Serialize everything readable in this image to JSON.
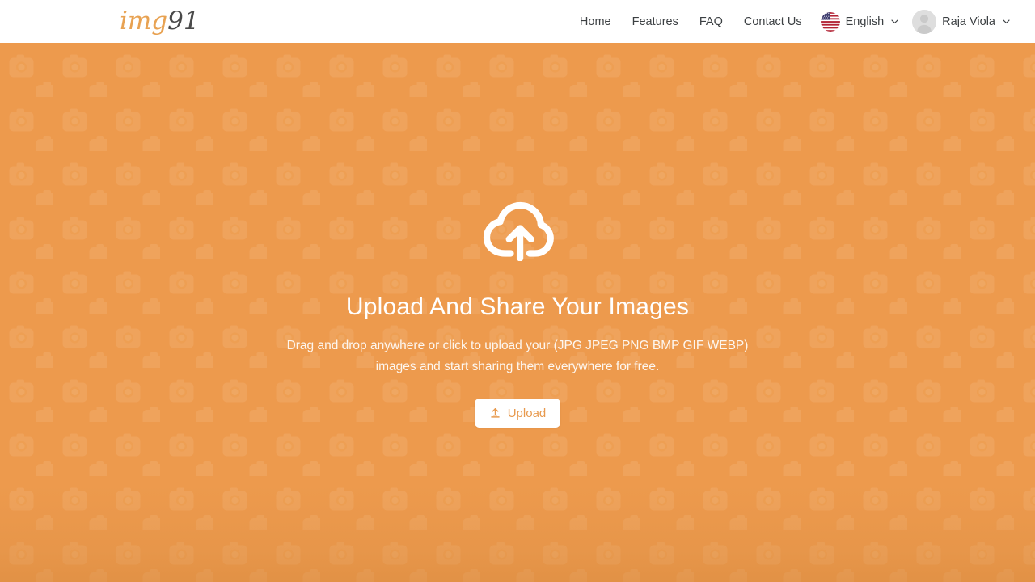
{
  "header": {
    "logo": {
      "name": "img91",
      "part_primary": "img",
      "part_secondary": "91",
      "color_primary": "#e8a252",
      "color_secondary": "#4a4a4a"
    },
    "nav_links": [
      {
        "label": "Home",
        "name": "nav-link-home"
      },
      {
        "label": "Features",
        "name": "nav-link-features"
      },
      {
        "label": "FAQ",
        "name": "nav-link-faq"
      },
      {
        "label": "Contact Us",
        "name": "nav-link-contact-us"
      }
    ],
    "language_selector": {
      "label": "English",
      "icon": "us-flag-icon",
      "chevron": "chevron-down-icon"
    },
    "user_menu": {
      "label": "Raja Viola",
      "icon": "avatar-icon",
      "chevron": "chevron-down-icon"
    }
  },
  "hero": {
    "icon": "cloud-upload-icon",
    "title": "Upload And Share Your Images",
    "subtitle": "Drag and drop anywhere or click to upload your (JPG JPEG PNG BMP GIF WEBP) images and start sharing them everywhere for free.",
    "upload_button": {
      "label": "Upload",
      "icon": "upload-icon"
    },
    "background_color": "#ed9a4d",
    "background_pattern": "camera-tile-pattern",
    "text_color": "#ffffff"
  }
}
